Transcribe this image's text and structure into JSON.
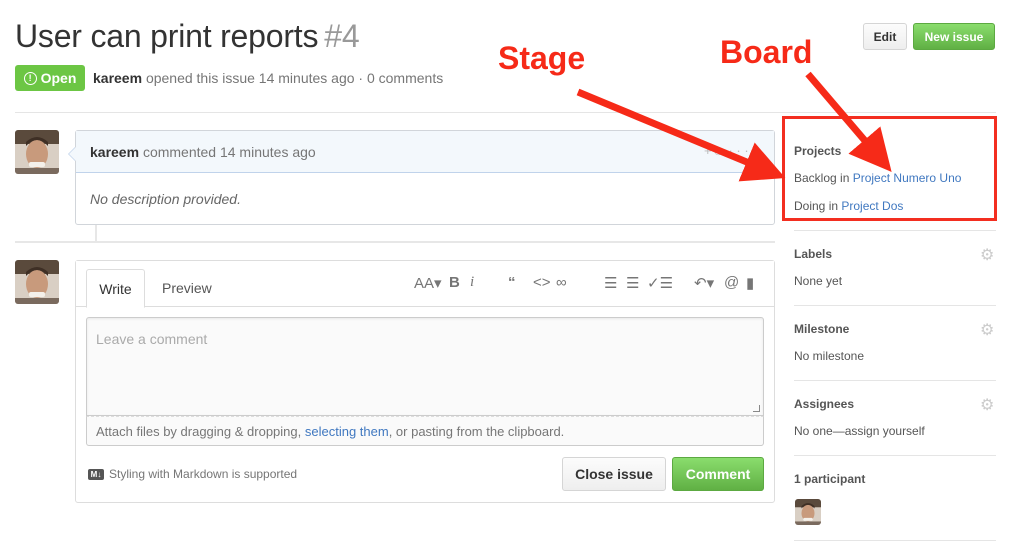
{
  "issue": {
    "title": "User can print reports",
    "number": "#4",
    "state": "Open",
    "author": "kareem",
    "meta_rest": "opened this issue 14 minutes ago · 0 comments"
  },
  "header": {
    "edit_label": "Edit",
    "new_issue_label": "New issue"
  },
  "comment": {
    "author": "kareem",
    "action": "commented 14 minutes ago",
    "body": "No description provided."
  },
  "form": {
    "tab_write": "Write",
    "tab_preview": "Preview",
    "placeholder": "Leave a comment",
    "attach_prefix": "Attach files by dragging & dropping,",
    "attach_link": "selecting them",
    "attach_suffix": ", or pasting from the clipboard.",
    "markdown_note": "Styling with Markdown is supported",
    "close_label": "Close issue",
    "comment_label": "Comment"
  },
  "sidebar": {
    "projects": {
      "heading": "Projects",
      "items": [
        {
          "stage": "Backlog in",
          "board": "Project Numero Uno"
        },
        {
          "stage": "Doing in",
          "board": "Project Dos"
        }
      ]
    },
    "labels": {
      "heading": "Labels",
      "value": "None yet"
    },
    "milestone": {
      "heading": "Milestone",
      "value": "No milestone"
    },
    "assignees": {
      "heading": "Assignees",
      "value": "No one—assign yourself"
    },
    "participants": {
      "heading": "1 participant"
    }
  },
  "annotations": {
    "stage": "Stage",
    "board": "Board",
    "color": "#f62a18"
  },
  "colors": {
    "open_green": "#6cc644",
    "link_blue": "#4078c0",
    "comment_header": "#f3f8fc"
  }
}
